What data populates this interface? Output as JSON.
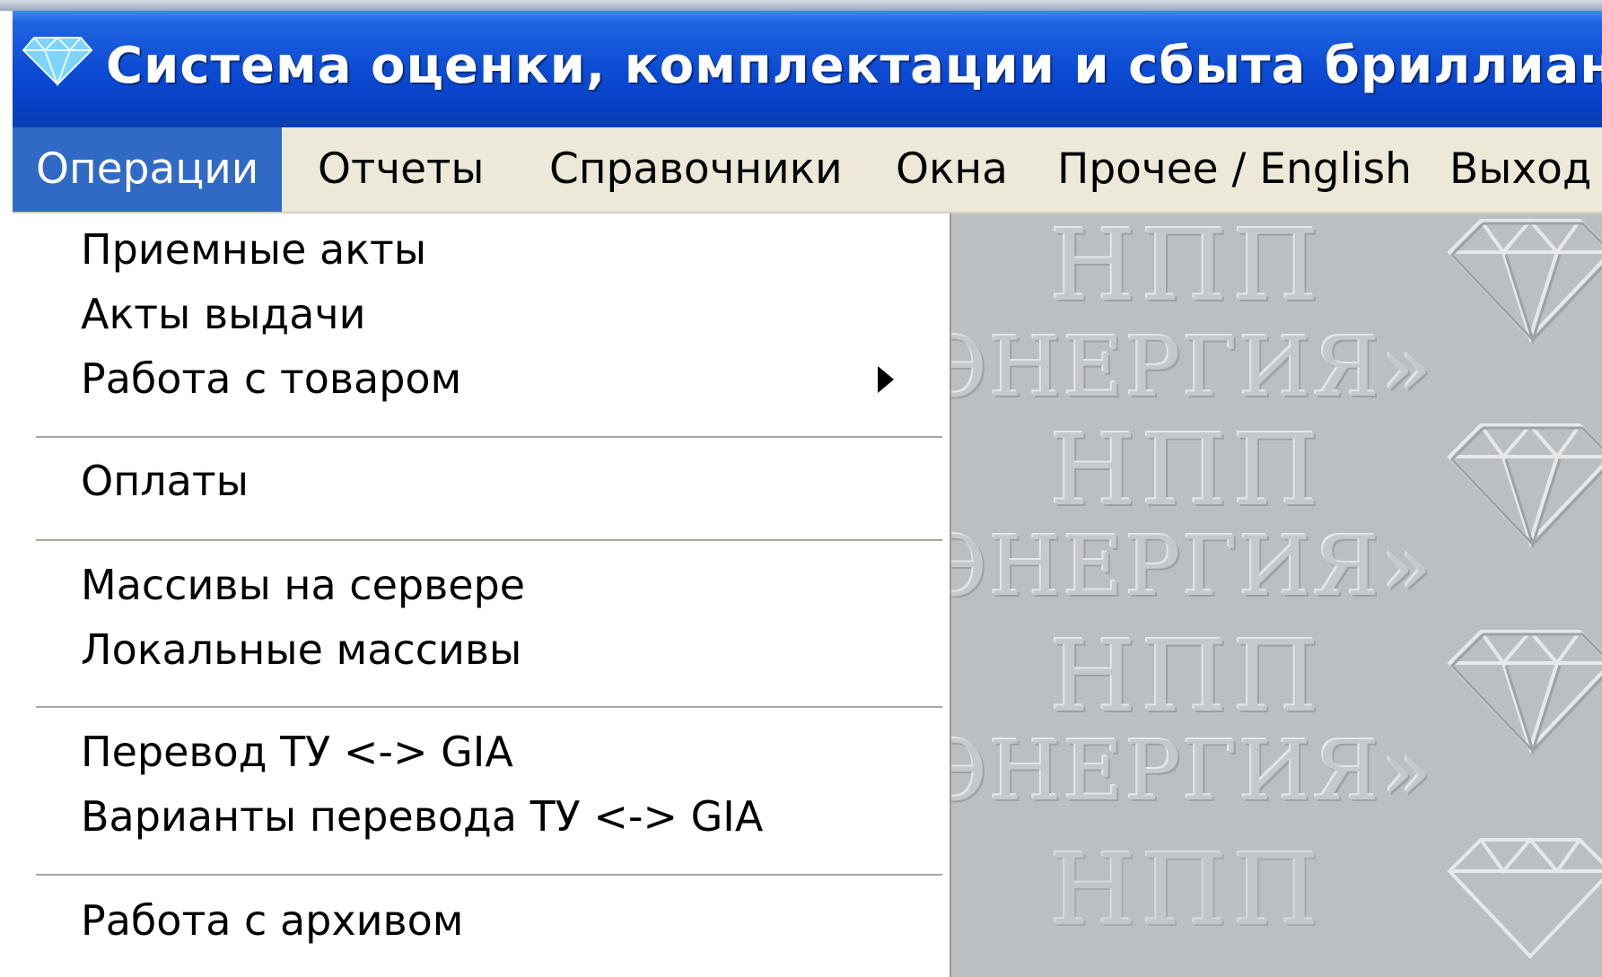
{
  "window": {
    "title": "Система оценки, комплектации и сбыта бриллиантов",
    "logo_icon": "diamond-icon"
  },
  "menubar": {
    "items": [
      {
        "label": "Операции",
        "active": true
      },
      {
        "label": "Отчеты"
      },
      {
        "label": "Справочники"
      },
      {
        "label": "Окна"
      },
      {
        "label": "Прочее / English"
      },
      {
        "label": "Выход"
      }
    ]
  },
  "dropdown": {
    "items": [
      {
        "label": "Приемные акты"
      },
      {
        "label": "Акты выдачи"
      },
      {
        "label": "Работа с товаром",
        "submenu": true
      },
      {
        "label": "Оплаты"
      },
      {
        "label": "Массивы на сервере"
      },
      {
        "label": "Локальные массивы"
      },
      {
        "label": "Перевод ТУ <-> GIA"
      },
      {
        "label": "Варианты перевода ТУ <-> GIA"
      },
      {
        "label": "Работа с архивом"
      }
    ]
  },
  "workspace": {
    "watermark": {
      "line1": "НПП",
      "line2": "ЭНЕРГИЯ»"
    }
  },
  "colors": {
    "titlebar": "#0a49d2",
    "menu_highlight": "#316ac5",
    "menubar_bg": "#ece9d8",
    "workspace_bg": "#bcbfc2"
  }
}
